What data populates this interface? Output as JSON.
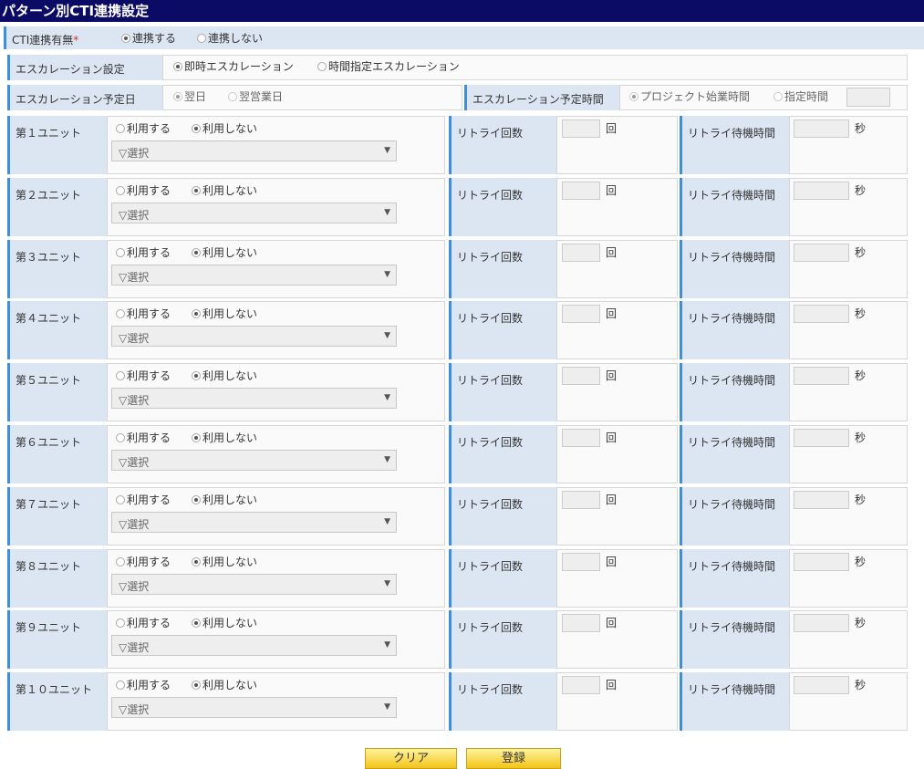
{
  "title": "パターン別CTI連携設定",
  "cti": {
    "label": "CTI連携有無",
    "required_mark": "*",
    "options": [
      "連携する",
      "連携しない"
    ],
    "selected": 0
  },
  "escalation": {
    "label": "エスカレーション設定",
    "options": [
      "即時エスカレーション",
      "時間指定エスカレーション"
    ],
    "selected": 0
  },
  "escalation_date": {
    "label": "エスカレーション予定日",
    "options": [
      "翌日",
      "翌営業日"
    ],
    "selected": 0
  },
  "escalation_time": {
    "label": "エスカレーション予定時間",
    "options": [
      "プロジェクト始業時間",
      "指定時間"
    ],
    "selected": 0,
    "value": ""
  },
  "unit_common": {
    "use_options": [
      "利用する",
      "利用しない"
    ],
    "select_placeholder": "▽選択",
    "select_arrow": "▼",
    "retry_label": "リトライ回数",
    "retry_unit": "回",
    "wait_label": "リトライ待機時間",
    "wait_unit": "秒"
  },
  "units": [
    {
      "name": "第１ユニット",
      "selected": 1,
      "retry": "",
      "wait": ""
    },
    {
      "name": "第２ユニット",
      "selected": 1,
      "retry": "",
      "wait": ""
    },
    {
      "name": "第３ユニット",
      "selected": 1,
      "retry": "",
      "wait": ""
    },
    {
      "name": "第４ユニット",
      "selected": 1,
      "retry": "",
      "wait": ""
    },
    {
      "name": "第５ユニット",
      "selected": 1,
      "retry": "",
      "wait": ""
    },
    {
      "name": "第６ユニット",
      "selected": 1,
      "retry": "",
      "wait": ""
    },
    {
      "name": "第７ユニット",
      "selected": 1,
      "retry": "",
      "wait": ""
    },
    {
      "name": "第８ユニット",
      "selected": 1,
      "retry": "",
      "wait": ""
    },
    {
      "name": "第９ユニット",
      "selected": 1,
      "retry": "",
      "wait": ""
    },
    {
      "name": "第１０ユニット",
      "selected": 1,
      "retry": "",
      "wait": ""
    }
  ],
  "buttons": {
    "clear": "クリア",
    "register": "登録"
  },
  "colors": {
    "title_bg": "#0b0b66",
    "label_bg": "#dce6f3",
    "label_accent": "#3e8fd8",
    "button": "#f2c416"
  }
}
